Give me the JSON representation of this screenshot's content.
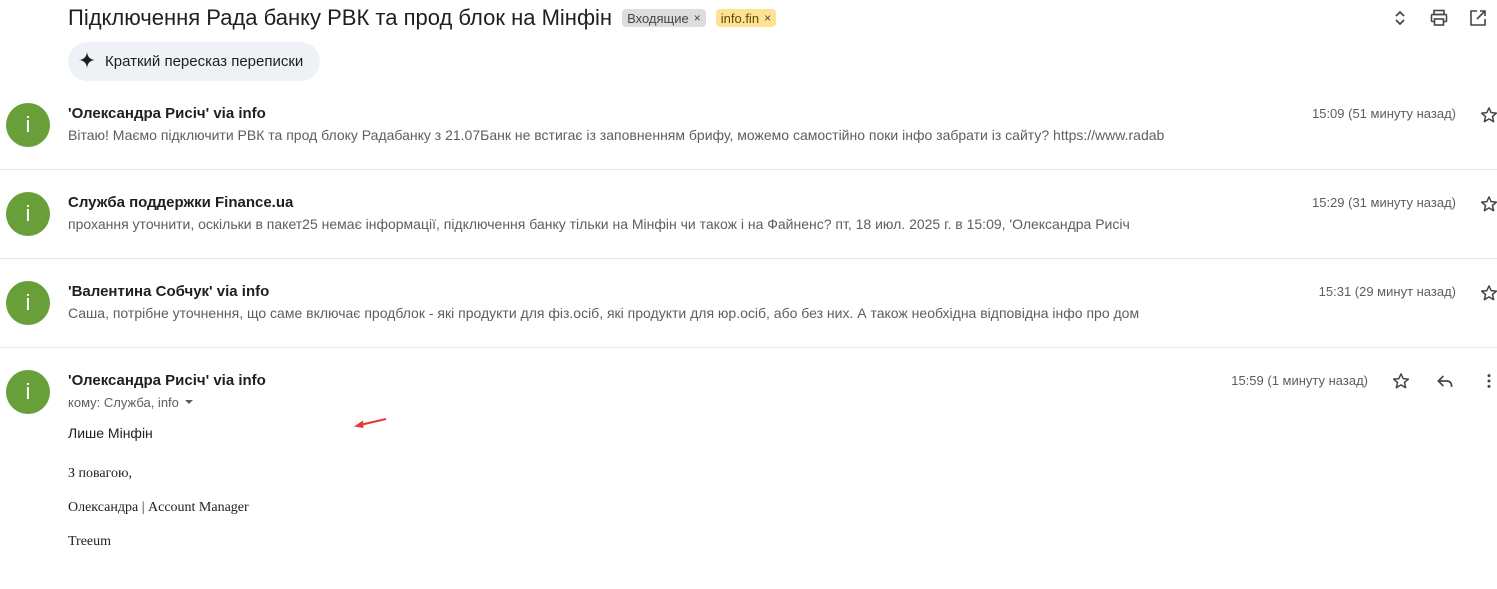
{
  "thread": {
    "subject": "Підключення Рада банку РВК та прод блок на Мінфін",
    "labels": [
      {
        "name": "Входящие",
        "remove": "×"
      },
      {
        "name": "info.fin",
        "remove": "×"
      }
    ],
    "actions": [
      "expand-collapse-icon",
      "print-icon",
      "open-in-new-window-icon"
    ],
    "summary_button": "Краткий пересказ переписки"
  },
  "messages": [
    {
      "avatar": "i",
      "sender": "'Олександра Рисіч' via info",
      "time": "15:09 (51 минуту назад)",
      "snippet": "Вітаю! Маємо підключити РВК та прод блоку Радабанку з 21.07Банк не встигає із заповненням брифу, можемо самостійно поки інфо забрати із сайту? https://www.radab"
    },
    {
      "avatar": "i",
      "sender": "Служба поддержки Finance.ua",
      "time": "15:29 (31 минуту назад)",
      "snippet": "прохання уточнити, оскільки в пакет25 немає інформації, підключення банку тільки на Мінфін чи також і на Файненс? пт, 18 июл. 2025 г. в 15:09, 'Олександра Рисіч"
    },
    {
      "avatar": "i",
      "sender": "'Валентина Собчук' via info",
      "time": "15:31 (29 минут назад)",
      "snippet": "Саша, потрібне уточнення, що саме включає продблок - які продукти для фіз.осіб, які продукти для юр.осіб, або без них. А також необхідна відповідна інфо про дом"
    }
  ],
  "expanded": {
    "avatar": "i",
    "sender": "'Олександра Рисіч' via info",
    "time": "15:59 (1 минуту назад)",
    "to": "кому: Служба, info",
    "body": "Лише Мінфін",
    "signature": [
      "З повагою,",
      "Олександра | Account Manager",
      "Treeum"
    ]
  },
  "colors": {
    "avatar": "#689f38",
    "label_inbox": "#dddddd",
    "label_info": "#fde293",
    "annotation_arrow": "#e53935"
  }
}
